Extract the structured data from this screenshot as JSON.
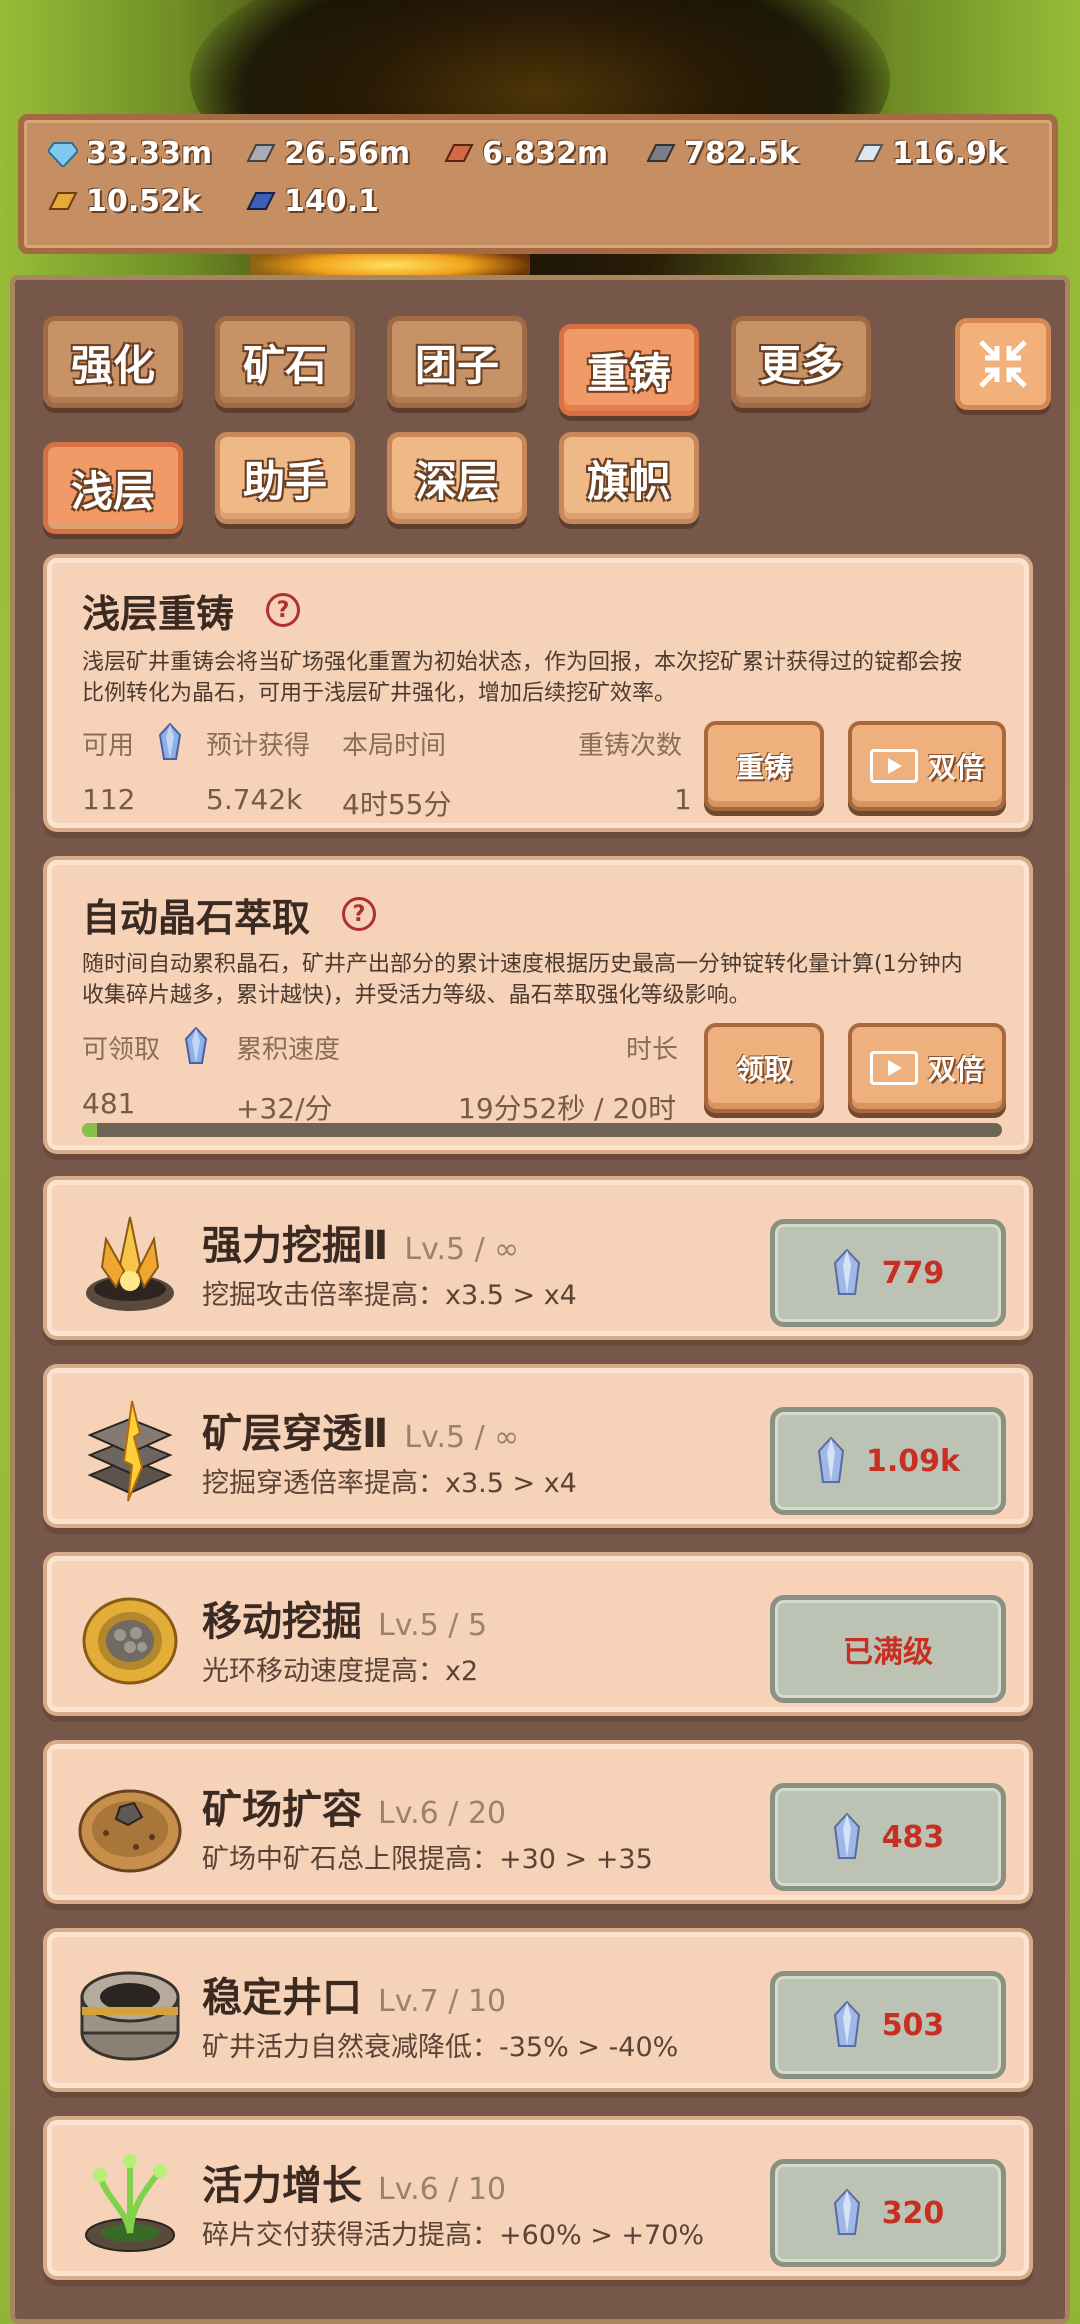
{
  "resources": [
    {
      "value": "33.33m",
      "icon": "diamond-icon",
      "color": "#7fc9f0"
    },
    {
      "value": "26.56m",
      "icon": "iron-ingot-icon",
      "color": "#a9adb3"
    },
    {
      "value": "6.832m",
      "icon": "copper-ingot-icon",
      "color": "#d36a43"
    },
    {
      "value": "782.5k",
      "icon": "dark-ingot-icon",
      "color": "#7a7e86"
    },
    {
      "value": "116.9k",
      "icon": "silver-ingot-icon",
      "color": "#dfe6ee"
    },
    {
      "value": "10.52k",
      "icon": "gold-ingot-icon",
      "color": "#e9a83a"
    },
    {
      "value": "140.1",
      "icon": "blue-ingot-icon",
      "color": "#3e5fb6"
    }
  ],
  "tabs": [
    "强化",
    "矿石",
    "团子",
    "重铸",
    "更多"
  ],
  "subtabs": [
    "浅层",
    "助手",
    "深层",
    "旗帜"
  ],
  "reforge": {
    "title": "浅层重铸",
    "help": "?",
    "desc_line1": "浅层矿井重铸会将当矿场强化重置为初始状态，作为回报，本次挖矿累计获得过的锭都会按",
    "desc_line2": "比例转化为晶石，可用于浅层矿井强化，增加后续挖矿效率。",
    "label_available": "可用",
    "label_expected": "预计获得",
    "label_time": "本局时间",
    "label_count": "重铸次数",
    "available": "112",
    "expected": "5.742k",
    "time": "4时55分",
    "count": "1",
    "btn_reforge": "重铸",
    "btn_double": "双倍"
  },
  "extract": {
    "title": "自动晶石萃取",
    "help": "?",
    "desc_line1": "随时间自动累积晶石，矿井产出部分的累计速度根据历史最高一分钟锭转化量计算(1分钟内",
    "desc_line2": "收集碎片越多，累计越快)，并受活力等级、晶石萃取强化等级影响。",
    "label_claimable": "可领取",
    "label_rate": "累积速度",
    "label_duration": "时长",
    "claimable": "481",
    "rate": "+32/分",
    "duration": "19分52秒 / 20时",
    "progress": 0.0166,
    "btn_claim": "领取",
    "btn_double": "双倍"
  },
  "upgrades": [
    {
      "name": "强力挖掘Ⅱ",
      "level": "Lv.5 / ∞",
      "desc": "挖掘攻击倍率提高：x3.5 > x4",
      "cost": "779",
      "icon": "fire-crystal-icon",
      "maxed": false
    },
    {
      "name": "矿层穿透Ⅱ",
      "level": "Lv.5 / ∞",
      "desc": "挖掘穿透倍率提高：x3.5 > x4",
      "cost": "1.09k",
      "icon": "stone-layers-icon",
      "maxed": false
    },
    {
      "name": "移动挖掘",
      "level": "Lv.5 / 5",
      "desc": "光环移动速度提高：x2",
      "cost": "已满级",
      "icon": "golden-disc-icon",
      "maxed": true
    },
    {
      "name": "矿场扩容",
      "level": "Lv.6 / 20",
      "desc": "矿场中矿石总上限提高：+30 > +35",
      "cost": "483",
      "icon": "ore-field-icon",
      "maxed": false
    },
    {
      "name": "稳定井口",
      "level": "Lv.7 / 10",
      "desc": "矿井活力自然衰减降低：-35% > -40%",
      "cost": "503",
      "icon": "well-ring-icon",
      "maxed": false
    },
    {
      "name": "活力增长",
      "level": "Lv.6 / 10",
      "desc": "碎片交付获得活力提高：+60% > +70%",
      "cost": "320",
      "icon": "green-sprout-icon",
      "maxed": false
    }
  ]
}
